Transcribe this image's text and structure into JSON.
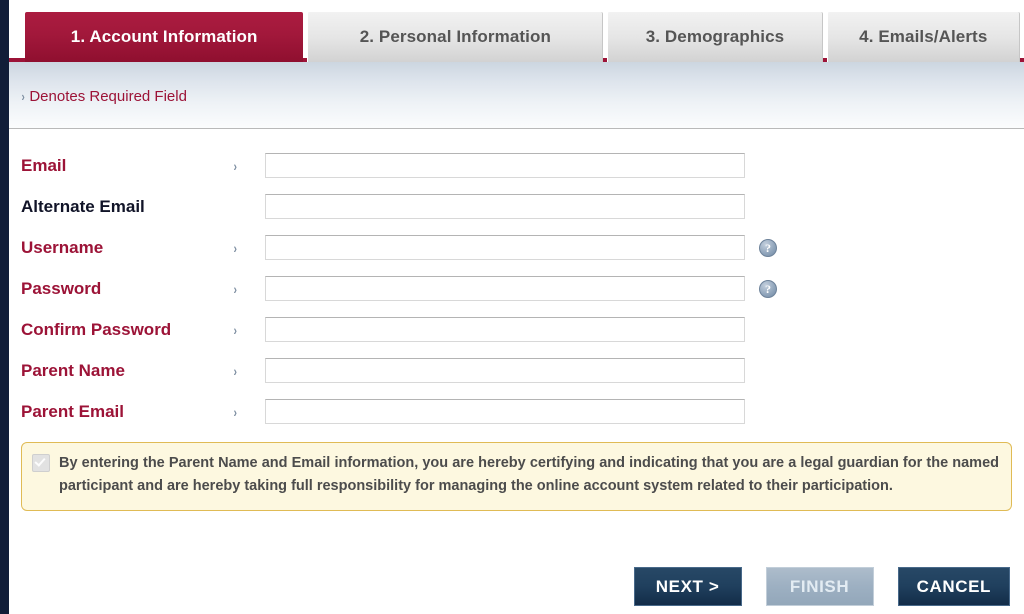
{
  "tabs": [
    {
      "label": "1. Account Information",
      "active": true
    },
    {
      "label": "2. Personal Information",
      "active": false
    },
    {
      "label": "3. Demographics",
      "active": false
    },
    {
      "label": "4. Emails/Alerts",
      "active": false
    }
  ],
  "banner": {
    "marker": "›",
    "text": "Denotes Required Field"
  },
  "form": {
    "required_marker": "›",
    "fields": [
      {
        "label": "Email",
        "required": true,
        "value": "",
        "placeholder": "",
        "info": false
      },
      {
        "label": "Alternate Email",
        "required": false,
        "value": "",
        "placeholder": "",
        "info": false
      },
      {
        "label": "Username",
        "required": true,
        "value": "",
        "placeholder": "",
        "info": true
      },
      {
        "label": "Password",
        "required": true,
        "value": "",
        "placeholder": "",
        "info": true
      },
      {
        "label": "Confirm Password",
        "required": true,
        "value": "",
        "placeholder": "",
        "info": false
      },
      {
        "label": "Parent Name",
        "required": true,
        "value": "",
        "placeholder": "",
        "info": false
      },
      {
        "label": "Parent Email",
        "required": true,
        "value": "",
        "placeholder": "",
        "info": false
      }
    ],
    "info_icon_glyph": "?"
  },
  "consent": {
    "checked": true,
    "enabled": false,
    "text": "By entering the Parent Name and Email information, you are hereby certifying and indicating that you are a legal guardian for the named participant and are hereby taking full responsibility for managing the online account system related to their participation."
  },
  "buttons": [
    {
      "label": "NEXT >",
      "disabled": false
    },
    {
      "label": "FINISH",
      "disabled": true
    },
    {
      "label": "CANCEL",
      "disabled": false
    }
  ],
  "colors": {
    "brand_crimson": "#9c1337",
    "tab_active": "#a2183b",
    "rail_navy": "#111d38",
    "button_navy": "#20405e",
    "consent_bg": "#fdf8e0",
    "consent_border": "#e0bb55",
    "marker_blue": "#7c8da0"
  }
}
